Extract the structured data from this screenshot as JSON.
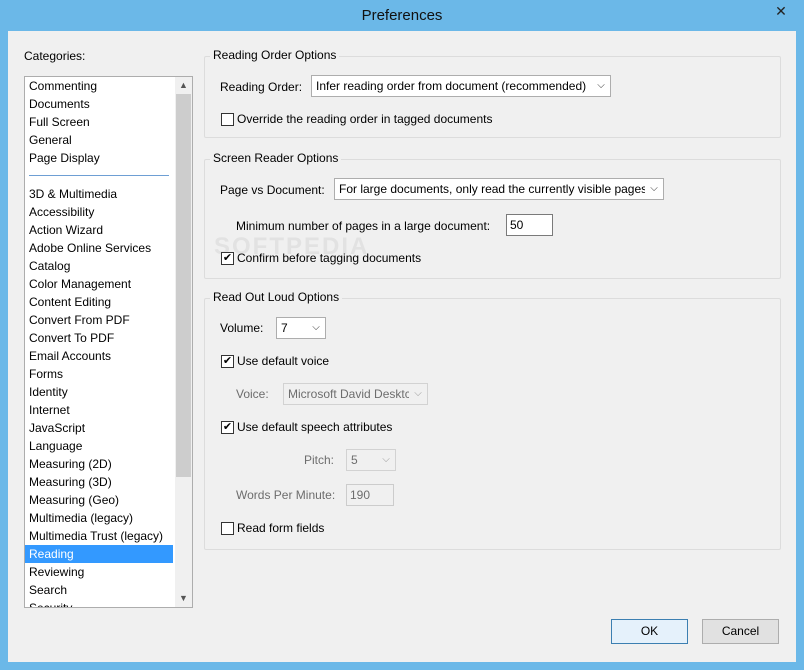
{
  "window": {
    "title": "Preferences",
    "close_symbol": "✕"
  },
  "categories": {
    "label": "Categories:",
    "group1": [
      "Commenting",
      "Documents",
      "Full Screen",
      "General",
      "Page Display"
    ],
    "group2": [
      "3D & Multimedia",
      "Accessibility",
      "Action Wizard",
      "Adobe Online Services",
      "Catalog",
      "Color Management",
      "Content Editing",
      "Convert From PDF",
      "Convert To PDF",
      "Email Accounts",
      "Forms",
      "Identity",
      "Internet",
      "JavaScript",
      "Language",
      "Measuring (2D)",
      "Measuring (3D)",
      "Measuring (Geo)",
      "Multimedia (legacy)",
      "Multimedia Trust (legacy)",
      "Reading",
      "Reviewing",
      "Search",
      "Security"
    ],
    "selected": "Reading"
  },
  "reading_order": {
    "group_title": "Reading Order Options",
    "label": "Reading Order:",
    "value": "Infer reading order from document (recommended)",
    "override_label": "Override the reading order in tagged documents",
    "override_checked": false
  },
  "screen_reader": {
    "group_title": "Screen Reader Options",
    "page_vs_doc_label": "Page vs Document:",
    "page_vs_doc_value": "For large documents, only read the currently visible pages",
    "min_pages_label": "Minimum number of pages in a large document:",
    "min_pages_value": "50",
    "confirm_label": "Confirm before tagging documents",
    "confirm_checked": true
  },
  "read_out_loud": {
    "group_title": "Read Out Loud Options",
    "volume_label": "Volume:",
    "volume_value": "7",
    "default_voice_label": "Use default voice",
    "default_voice_checked": true,
    "voice_label": "Voice:",
    "voice_value": "Microsoft David Desktc",
    "default_speech_label": "Use default speech attributes",
    "default_speech_checked": true,
    "pitch_label": "Pitch:",
    "pitch_value": "5",
    "wpm_label": "Words Per Minute:",
    "wpm_value": "190",
    "form_fields_label": "Read form fields",
    "form_fields_checked": false
  },
  "buttons": {
    "ok": "OK",
    "cancel": "Cancel"
  },
  "watermark": "SOFTPEDIA",
  "colors": {
    "titlebar": "#6bb8e8",
    "selection": "#3399ff",
    "dialog_bg": "#f0f0f0"
  }
}
